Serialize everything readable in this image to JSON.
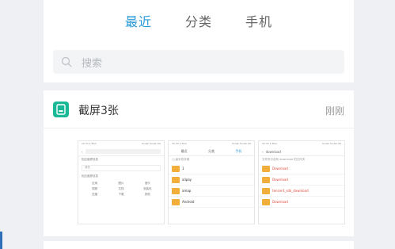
{
  "tabs": [
    {
      "label": "最近",
      "active": true
    },
    {
      "label": "分类",
      "active": false
    },
    {
      "label": "手机",
      "active": false
    }
  ],
  "search": {
    "placeholder": "搜索"
  },
  "card": {
    "title": "截屏3张",
    "time": "刚刚",
    "thumbnails": [
      {
        "status": "15:33  1.5K/s",
        "status_right": "Sousk  Sousk 4G",
        "section1": "相应截屏信息",
        "box": "请先",
        "section2": "相应截屏信息",
        "grid": [
          "应用",
          "图片",
          "音乐",
          "视频",
          "文档",
          "安装包",
          "压缩",
          "下载",
          "其他"
        ]
      },
      {
        "status": "15:33  1.5K/s",
        "status_right": "Sousk  Sousk 4G",
        "nav": [
          "最近",
          "分类",
          "手机"
        ],
        "path": "/上级手机存储",
        "folders": [
          "1",
          "alipay",
          "amap",
          "Android"
        ]
      },
      {
        "status": "15:33  1.5K/s",
        "status_right": "Sousk  Sousk 4G",
        "query": "download",
        "section": "文件夹中含有 download 的文件夹",
        "folders": [
          "Download",
          "Download",
          "tencent_sdk_download",
          "Download"
        ]
      }
    ]
  },
  "colors": {
    "accent": "#2a9ad8",
    "app_icon": "#19b896",
    "folder": "#f2ae3a",
    "highlight": "#e24b3b"
  }
}
